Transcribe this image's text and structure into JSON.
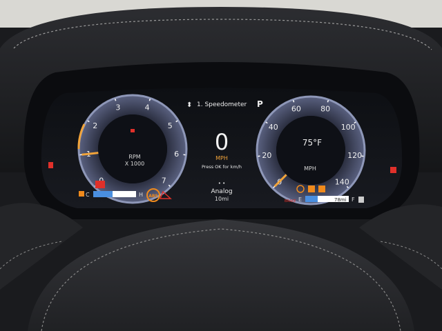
{
  "menu": {
    "title": "1. Speedometer"
  },
  "gear": {
    "indicator": "P"
  },
  "center": {
    "speed": "0",
    "unit": "MPH",
    "hint": "Press OK for km/h",
    "mode": "Analog",
    "range": "10mi"
  },
  "tach": {
    "ticks": [
      "0",
      "1",
      "2",
      "3",
      "4",
      "5",
      "6",
      "7"
    ],
    "label1": "RPM",
    "label2": "X 1000",
    "value_krpm": 1.0,
    "temp_low": "C",
    "temp_high": "H",
    "abs": "ABS"
  },
  "speedo": {
    "ticks": [
      "0",
      "20",
      "40",
      "60",
      "80",
      "100",
      "120",
      "140"
    ],
    "value_mph": 0,
    "outside_temp": "75°F",
    "unit": "MPH",
    "fuel_empty": "E",
    "fuel_full": "F",
    "fuel_range": "78mi",
    "brake": "BRAKE"
  },
  "colors": {
    "needle": "#f2a43a",
    "warning_red": "#e0302a",
    "warning_amber": "#f08a1c",
    "gauge_blue": "#7e8fb8",
    "gauge_fill": "#4a4f63",
    "bar_blue": "#4a8fe0"
  },
  "icons": [
    "seatbelt-icon",
    "coolant-temp-icon",
    "abs-warning-icon",
    "parking-brake-icon",
    "tire-pressure-icon",
    "fuel-pump-icon",
    "airbag-icon",
    "stability-control-icon"
  ]
}
